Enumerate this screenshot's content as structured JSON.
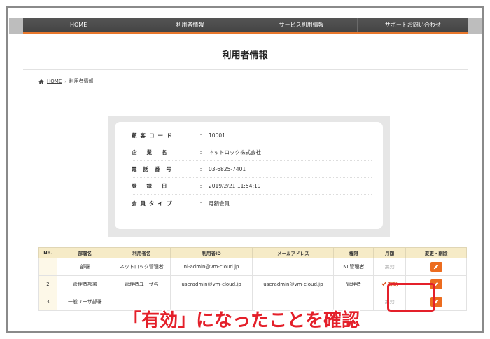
{
  "nav": [
    "HOME",
    "利用者情報",
    "サービス利用情報",
    "サポートお問い合わせ"
  ],
  "page_title": "利用者情報",
  "breadcrumb": {
    "home": "HOME",
    "separator": "›",
    "current": "利用者情報"
  },
  "info": [
    {
      "label": "顧客コード",
      "value": "10001"
    },
    {
      "label": "企業名",
      "value": "ネットロック株式会社"
    },
    {
      "label": "電話番号",
      "value": "03-6825-7401"
    },
    {
      "label": "登録日",
      "value": "2019/2/21 11:54:19"
    },
    {
      "label": "会員タイプ",
      "value": "月額会員"
    }
  ],
  "table": {
    "headers": [
      "No.",
      "部署名",
      "利用者名",
      "利用者ID",
      "メールアドレス",
      "権限",
      "月額",
      "変更・削除"
    ],
    "rows": [
      {
        "no": "1",
        "dept": "部署",
        "name": "ネットロック管理者",
        "id": "nl-admin@vm-cloud.jp",
        "email": "",
        "role": "NL管理者",
        "status": "無効"
      },
      {
        "no": "2",
        "dept": "管理者部署",
        "name": "管理者ユーザ名",
        "id": "useradmin@vm-cloud.jp",
        "email": "useradmin@vm-cloud.jp",
        "role": "管理者",
        "status": "有効"
      },
      {
        "no": "3",
        "dept": "一般ユーザ部署",
        "name": "",
        "id": "",
        "email": "",
        "role": "",
        "status": "無効"
      }
    ]
  },
  "caption": "「有効」になったことを確認",
  "colors": {
    "accent": "#e8772c",
    "highlight": "#e4202a",
    "header_bg": "#f6ebc7"
  }
}
